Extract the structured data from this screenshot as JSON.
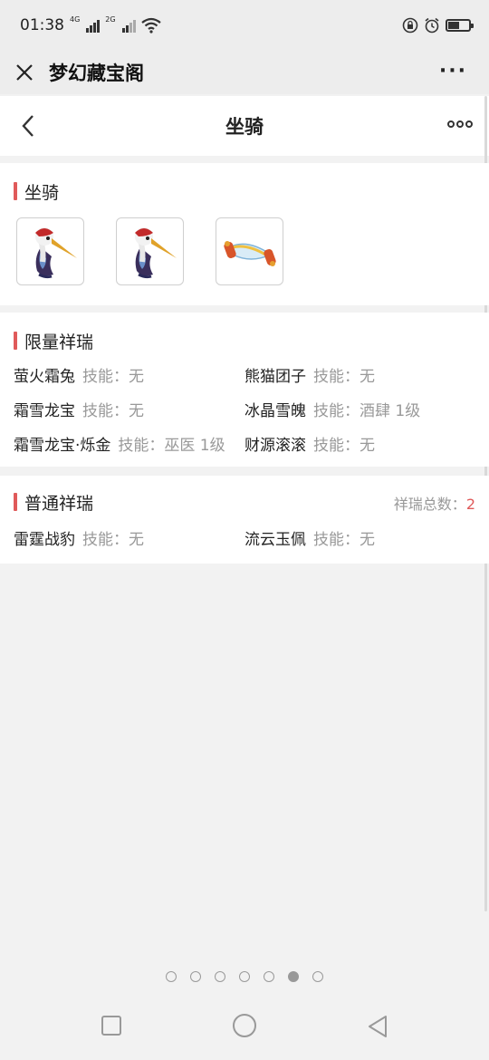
{
  "status_bar": {
    "time": "01:38",
    "network_1": "4G",
    "network_2": "2G",
    "battery_level": 0.55
  },
  "mini_program_header": {
    "title": "梦幻藏宝阁",
    "more_label": "···"
  },
  "page_header": {
    "title": "坐骑"
  },
  "mounts_section": {
    "title": "坐骑",
    "items": [
      {
        "icon": "crane-mount-icon"
      },
      {
        "icon": "crane-mount-icon"
      },
      {
        "icon": "scroll-mount-icon"
      }
    ]
  },
  "limited_section": {
    "title": "限量祥瑞",
    "items": [
      {
        "name": "萤火霜兔",
        "skill": "技能：无"
      },
      {
        "name": "熊猫团子",
        "skill": "技能：无"
      },
      {
        "name": "霜雪龙宝",
        "skill": "技能：无"
      },
      {
        "name": "冰晶雪魄",
        "skill": "技能：酒肆 1级"
      },
      {
        "name": "霜雪龙宝·烁金",
        "skill": "技能：巫医 1级"
      },
      {
        "name": "财源滚滚",
        "skill": "技能：无"
      }
    ]
  },
  "normal_section": {
    "title": "普通祥瑞",
    "total_label": "祥瑞总数：",
    "total_value": "2",
    "items": [
      {
        "name": "雷霆战豹",
        "skill": "技能：无"
      },
      {
        "name": "流云玉佩",
        "skill": "技能：无"
      }
    ]
  },
  "pager": {
    "count": 7,
    "active_index": 5
  },
  "colors": {
    "accent": "#e05a5a",
    "muted_text": "#999999",
    "background": "#f2f2f2"
  }
}
